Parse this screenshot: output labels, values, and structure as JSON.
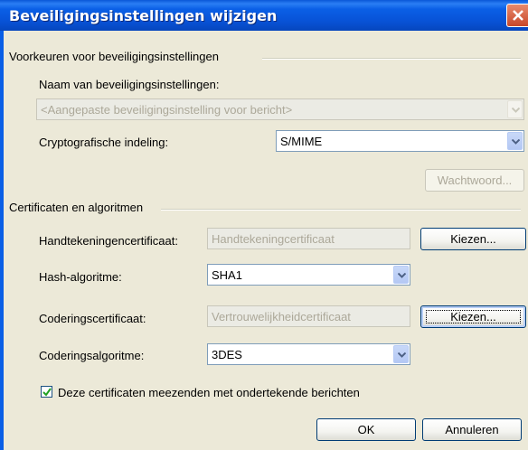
{
  "window": {
    "title": "Beveiligingsinstellingen wijzigen"
  },
  "group1": {
    "title": "Voorkeuren voor beveiligingsinstellingen",
    "name_label": "Naam van beveiligingsinstellingen:",
    "name_value": "<Aangepaste beveiligingsinstelling voor bericht>",
    "format_label": "Cryptografische indeling:",
    "format_value": "S/MIME",
    "password_button": "Wachtwoord..."
  },
  "group2": {
    "title": "Certificaten en algoritmen",
    "sign_cert_label": "Handtekeningencertificaat:",
    "sign_cert_value": "Handtekeningcertificaat",
    "choose_button_1": "Kiezen...",
    "hash_label": "Hash-algoritme:",
    "hash_value": "SHA1",
    "enc_cert_label": "Coderingscertificaat:",
    "enc_cert_value": "Vertrouwelijkheidcertificaat",
    "choose_button_2": "Kiezen...",
    "enc_alg_label": "Coderingsalgoritme:",
    "enc_alg_value": "3DES",
    "send_certs_label": "Deze certificaten meezenden met ondertekende berichten",
    "send_certs_checked": true
  },
  "buttons": {
    "ok": "OK",
    "cancel": "Annuleren"
  },
  "icons": {
    "close": "close-icon",
    "dropdown": "chevron-down-icon",
    "check": "checkmark-icon"
  },
  "colors": {
    "titlebar": "#0a5fe6",
    "dialog_bg": "#ece9d8",
    "disabled_text": "#aca899"
  }
}
